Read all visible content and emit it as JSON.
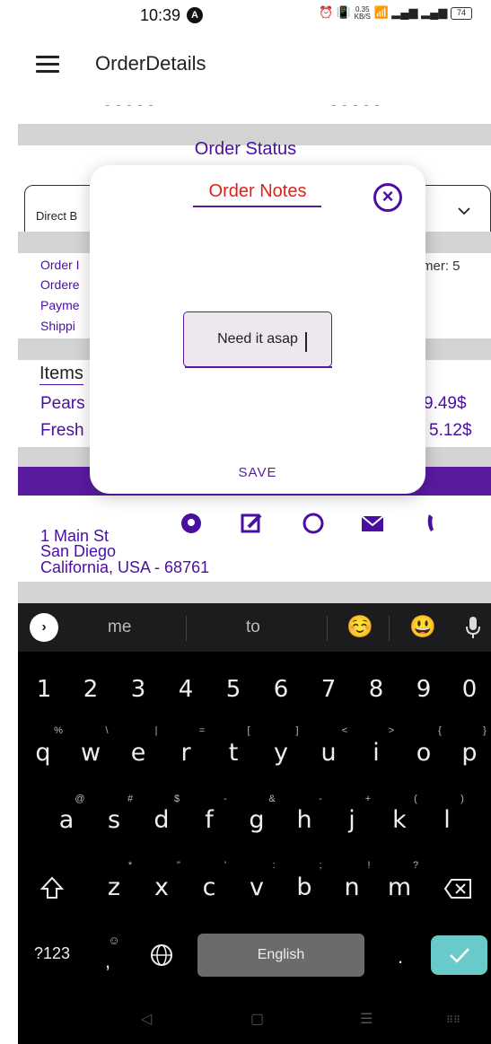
{
  "status_bar": {
    "time": "10:39",
    "app_icon": "A",
    "speed_value": "0.35",
    "speed_unit": "KB/S",
    "battery": "74"
  },
  "app_bar": {
    "title": "OrderDetails"
  },
  "background": {
    "order_status_heading": "Order Status",
    "dropdown_value": "Direct B",
    "info_lines": [
      "Order I",
      "Ordere",
      "Payme",
      "Shippi"
    ],
    "customer_label": "mer: 5",
    "items_heading": "Items",
    "items": [
      {
        "name": "Pears",
        "price": "9.49$"
      },
      {
        "name": "Fresh",
        "price": "5.12$"
      }
    ],
    "address": [
      "1 Main St",
      "San Diego",
      "California, USA - 68761"
    ]
  },
  "dialog": {
    "title": "Order Notes",
    "note_value": "Need it asap",
    "save_label": "SAVE"
  },
  "keyboard": {
    "suggestions": [
      "me",
      "to"
    ],
    "emoji_suggestions": [
      "☺️",
      "😃"
    ],
    "number_row": [
      "1",
      "2",
      "3",
      "4",
      "5",
      "6",
      "7",
      "8",
      "9",
      "0"
    ],
    "row1": [
      "q",
      "w",
      "e",
      "r",
      "t",
      "y",
      "u",
      "i",
      "o",
      "p"
    ],
    "row1_hints": [
      "%",
      "\\",
      "|",
      "=",
      "[",
      "]",
      "<",
      ">",
      "{",
      "}"
    ],
    "row2": [
      "a",
      "s",
      "d",
      "f",
      "g",
      "h",
      "j",
      "k",
      "l"
    ],
    "row2_hints": [
      "@",
      "#",
      "$",
      "-",
      "&",
      "-",
      "+",
      "(",
      ")"
    ],
    "row3": [
      "z",
      "x",
      "c",
      "v",
      "b",
      "n",
      "m"
    ],
    "row3_hints": [
      "*",
      "\"",
      "'",
      ":",
      ";",
      "!",
      "?"
    ],
    "symbols_label": "?123",
    "comma": ",",
    "comma_hint": "☺",
    "space_label": "English",
    "period": "."
  },
  "colors": {
    "accent_purple": "#4a0fa0",
    "title_red": "#e0201c",
    "enter_teal": "#6ac9c9"
  }
}
